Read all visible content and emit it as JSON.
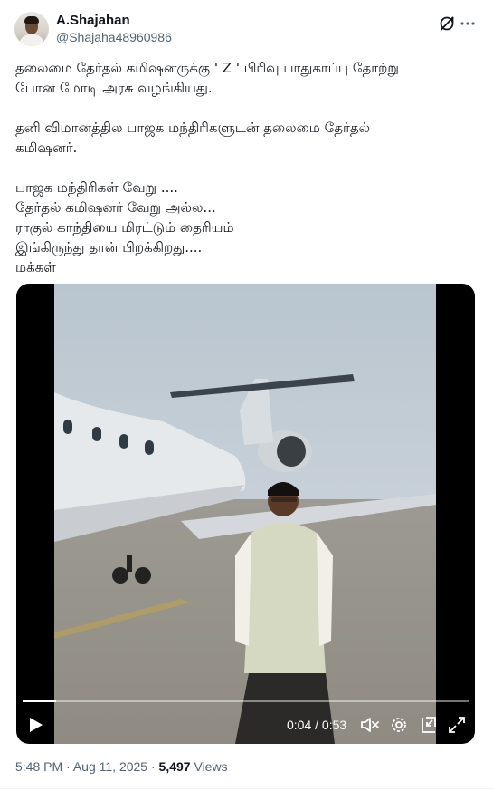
{
  "author": {
    "display_name": "A.Shajahan",
    "handle": "@Shajaha48960986"
  },
  "icons": {
    "grok": "grok-icon",
    "more": "more-icon",
    "play": "play-icon",
    "volume": "volume-muted-icon",
    "settings": "settings-icon",
    "pip": "picture-in-picture-icon",
    "fullscreen": "fullscreen-icon"
  },
  "tweet": {
    "paragraphs": [
      "தலைமை தேர்தல் கமிஷனருக்கு ' Z ' பிரிவு பாதுகாப்பு தோற்று\nபோன மோடி அரசு வழங்கியது.",
      "தனி விமானத்தில பாஜக மந்திரிகளுடன் தலைமை தேர்தல்\nகமிஷனர்.",
      "பாஜக மந்திரிகள் வேறு ....\nதேர்தல் கமிஷனர் வேறு அல்ல...\nராகுல் காந்தியை மிரட்டும் தைரியம்\nஇங்கிருந்து தான் பிறக்கிறது....\nமக்கள்"
    ]
  },
  "video": {
    "elapsed": "0:04",
    "separator": "/",
    "duration": "0:53",
    "progress_fraction": 0.075
  },
  "meta": {
    "time": "5:48 PM",
    "dot": "·",
    "date": "Aug 11, 2025",
    "views_count": "5,497",
    "views_label": "Views"
  },
  "colors": {
    "text": "#0f1419",
    "secondary": "#536471",
    "video_bg": "#000000"
  }
}
